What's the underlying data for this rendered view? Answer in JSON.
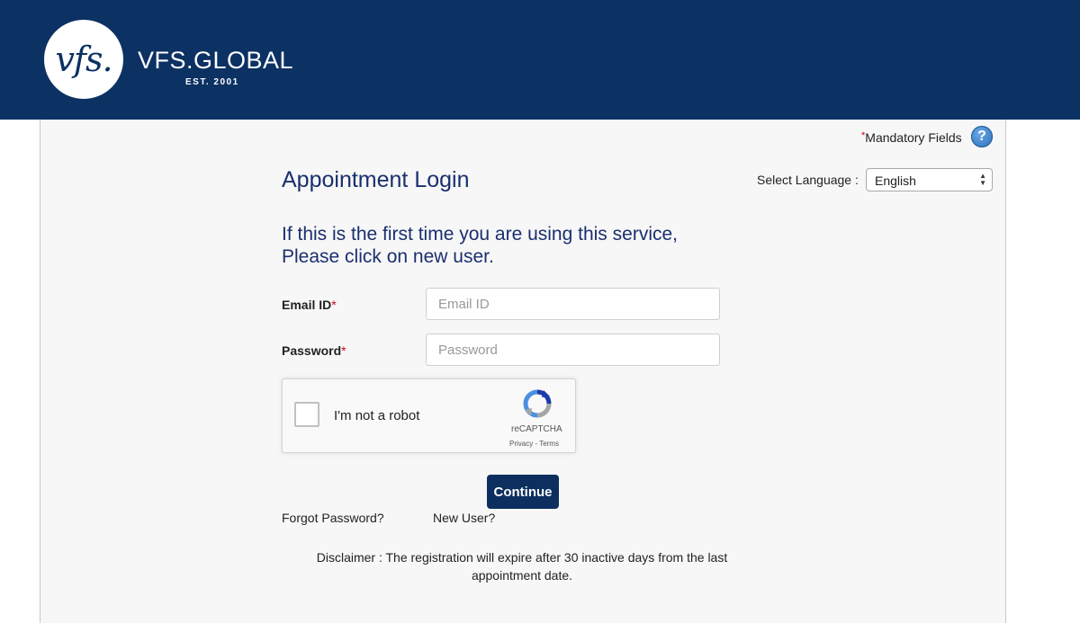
{
  "header": {
    "logo_monogram": "vfs.",
    "logo_name": "VFS.GLOBAL",
    "logo_est": "EST. 2001",
    "background_color": "#0c3163"
  },
  "mandatory": {
    "star": "*",
    "label": "Mandatory Fields",
    "help_icon": "help-question-icon",
    "help_glyph": "?"
  },
  "page": {
    "title": "Appointment Login"
  },
  "language": {
    "label": "Select Language :",
    "selected": "English"
  },
  "intro": {
    "line1": "If this is the first time you are using this service,",
    "line2": "Please click on new user."
  },
  "form": {
    "email_label": "Email ID",
    "email_placeholder": "Email ID",
    "email_value": "",
    "password_label": "Password",
    "password_placeholder": "Password",
    "password_value": "",
    "required_marker": "*"
  },
  "recaptcha": {
    "label": "I'm not a robot",
    "brand": "reCAPTCHA",
    "terms": "Privacy - Terms",
    "checked": false
  },
  "actions": {
    "continue_label": "Continue",
    "forgot_password": "Forgot Password?",
    "new_user": "New User?"
  },
  "disclaimer": {
    "line1": "Disclaimer : The registration will expire after 30 inactive days from the last",
    "line2": "appointment date."
  },
  "colors": {
    "brand_navy": "#0c3163",
    "title_blue": "#1a2f6e",
    "required_red": "#d0021b",
    "button_navy": "#0c2f5f"
  }
}
